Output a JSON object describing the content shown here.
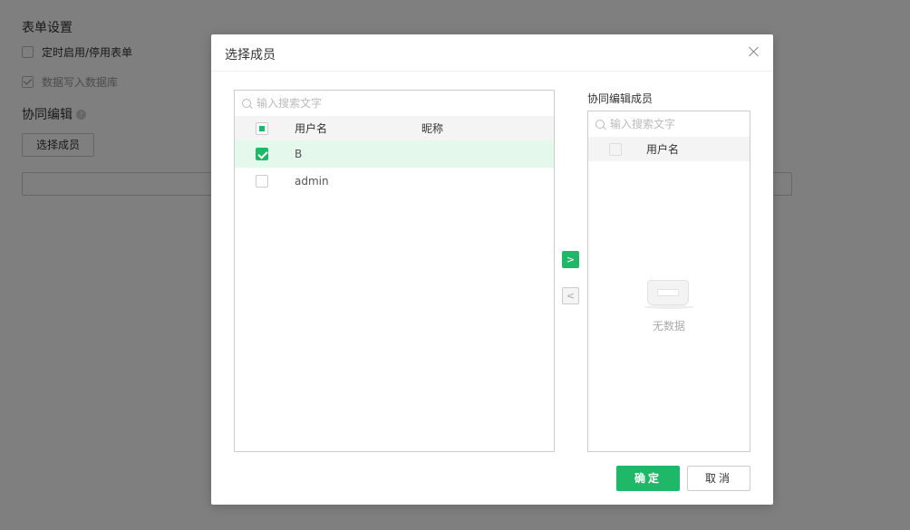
{
  "background": {
    "section_title": "表单设置",
    "options": [
      {
        "label": "定时启用/停用表单",
        "checked": false
      },
      {
        "label": "数据写入数据库",
        "checked": true
      }
    ],
    "collab_title": "协同编辑",
    "select_button": "选择成员"
  },
  "modal": {
    "title": "选择成员",
    "left": {
      "search_placeholder": "输入搜索文字",
      "header": {
        "username": "用户名",
        "nickname": "昵称"
      },
      "rows": [
        {
          "username": "B",
          "nickname": "",
          "checked": true
        },
        {
          "username": "admin",
          "nickname": "",
          "checked": false
        }
      ]
    },
    "right": {
      "label": "协同编辑成员",
      "search_placeholder": "输入搜索文字",
      "header": {
        "username": "用户名"
      },
      "empty_text": "无数据"
    },
    "transfer": {
      "to_right": ">",
      "to_left": "<"
    },
    "ok_label": "确定",
    "cancel_label": "取消"
  },
  "colors": {
    "accent": "#1fb868",
    "selected_row": "#e5f8ec"
  }
}
